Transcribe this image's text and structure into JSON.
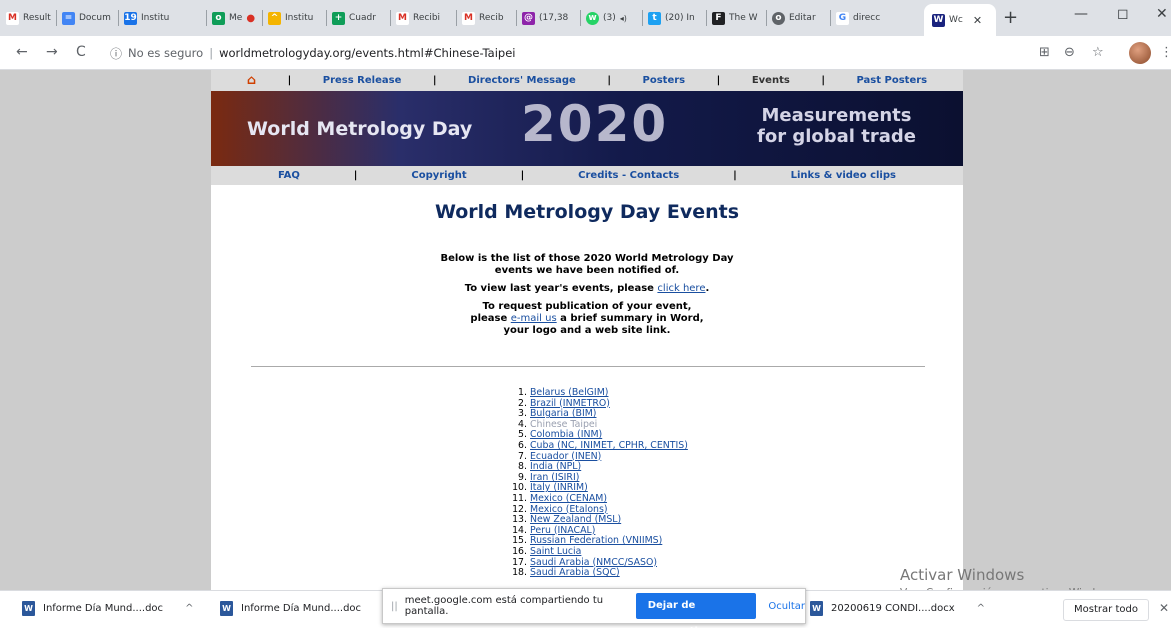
{
  "tabs": [
    {
      "label": "Result",
      "icon": "gmail-icon",
      "color": "#d93025",
      "glyph": "M"
    },
    {
      "label": "Docum",
      "icon": "docs-icon",
      "color": "#4285f4",
      "glyph": "="
    },
    {
      "label": "Institu",
      "icon": "calendar-icon",
      "color": "#1a73e8",
      "glyph": "19"
    },
    {
      "label": "Me",
      "icon": "meet-icon",
      "color": "#0f9d58",
      "glyph": "o"
    },
    {
      "label": "Institu",
      "icon": "drive-icon",
      "color": "#f4b400",
      "glyph": "^"
    },
    {
      "label": "Cuadr",
      "icon": "sheets-icon",
      "color": "#0f9d58",
      "glyph": "+"
    },
    {
      "label": "Recibi",
      "icon": "gmail-icon",
      "color": "#d93025",
      "glyph": "M"
    },
    {
      "label": "Recib",
      "icon": "gmail-icon",
      "color": "#d93025",
      "glyph": "M"
    },
    {
      "label": "(17,38",
      "icon": "mail-icon",
      "color": "#8e24aa",
      "glyph": "@"
    },
    {
      "label": "(3)",
      "icon": "whatsapp-icon",
      "color": "#25d366",
      "glyph": "w"
    },
    {
      "label": "(20) In",
      "icon": "twitter-icon",
      "color": "#1da1f2",
      "glyph": "t"
    },
    {
      "label": "The W",
      "icon": "f-icon",
      "color": "#202124",
      "glyph": "F"
    },
    {
      "label": "Editar",
      "icon": "globe-icon",
      "color": "#5f6368",
      "glyph": "o"
    },
    {
      "label": "direcc",
      "icon": "google-icon",
      "color": "#4285f4",
      "glyph": "G"
    },
    {
      "label": "Wc",
      "icon": "site-icon",
      "color": "#1a237e",
      "glyph": "W"
    }
  ],
  "window_controls": {
    "minimize": "—",
    "maximize": "◻",
    "close": "✕"
  },
  "address": {
    "security": "No es seguro",
    "url": "worldmetrologyday.org/events.html#Chinese-Taipei"
  },
  "site": {
    "top_nav": [
      "Press Release",
      "Directors' Message",
      "Posters",
      "Events",
      "Past Posters"
    ],
    "nav_sep": "|",
    "banner": {
      "title": "World Metrology Day",
      "year": "2020",
      "slogan_line1": "Measurements",
      "slogan_line2": "for global trade"
    },
    "bottom_nav": [
      "FAQ",
      "Copyright",
      "Credits - Contacts",
      "Links & video clips"
    ],
    "heading": "World Metrology Day Events",
    "intro_line1": "Below is the list of those 2020 World Metrology Day",
    "intro_line2": "events we have been notified of.",
    "last_year_prefix": "To view last year's events, please",
    "last_year_link": "click here",
    "last_year_suffix": ".",
    "request_line1": "To request publication of your event,",
    "request_line2_prefix": "please",
    "request_email_link": "e-mail us",
    "request_line2_suffix": "a brief summary in Word,",
    "request_line3": "your logo and a web site link.",
    "events": [
      {
        "num": "1.",
        "name": "Belarus (BelGIM)"
      },
      {
        "num": "2.",
        "name": "Brazil (INMETRO)"
      },
      {
        "num": "3.",
        "name": "Bulgaria (BIM)"
      },
      {
        "num": "4.",
        "name": "Chinese Taipei"
      },
      {
        "num": "5.",
        "name": "Colombia (INM)"
      },
      {
        "num": "6.",
        "name": "Cuba (NC, INIMET, CPHR, CENTIS)"
      },
      {
        "num": "7.",
        "name": "Ecuador (INEN)"
      },
      {
        "num": "8.",
        "name": "India (NPL)"
      },
      {
        "num": "9.",
        "name": "Iran (ISIRI)"
      },
      {
        "num": "10.",
        "name": "Italy (INRIM)"
      },
      {
        "num": "11.",
        "name": "Mexico (CENAM)"
      },
      {
        "num": "12.",
        "name": "Mexico (Etalons)"
      },
      {
        "num": "13.",
        "name": "New Zealand (MSL)"
      },
      {
        "num": "14.",
        "name": "Peru (INACAL)"
      },
      {
        "num": "15.",
        "name": "Russian Federation (VNIIMS)"
      },
      {
        "num": "16.",
        "name": "Saint Lucia"
      },
      {
        "num": "17.",
        "name": "Saudi Arabia (NMCC/SASO)"
      },
      {
        "num": "18.",
        "name": "Saudi Arabia (SQC)"
      }
    ]
  },
  "watermark": {
    "line1": "Activar Windows",
    "line2": "Ve a Configuración para activar Windows."
  },
  "downloads": {
    "items": [
      "Informe Día Mund....doc",
      "Informe Día Mund....doc",
      "20200619 CONDI....docx"
    ],
    "show_all": "Mostrar todo"
  },
  "share_bar": {
    "message": "meet.google.com está compartiendo tu pantalla.",
    "stop_button": "Dejar de compartir",
    "hide_button": "Ocultar"
  }
}
